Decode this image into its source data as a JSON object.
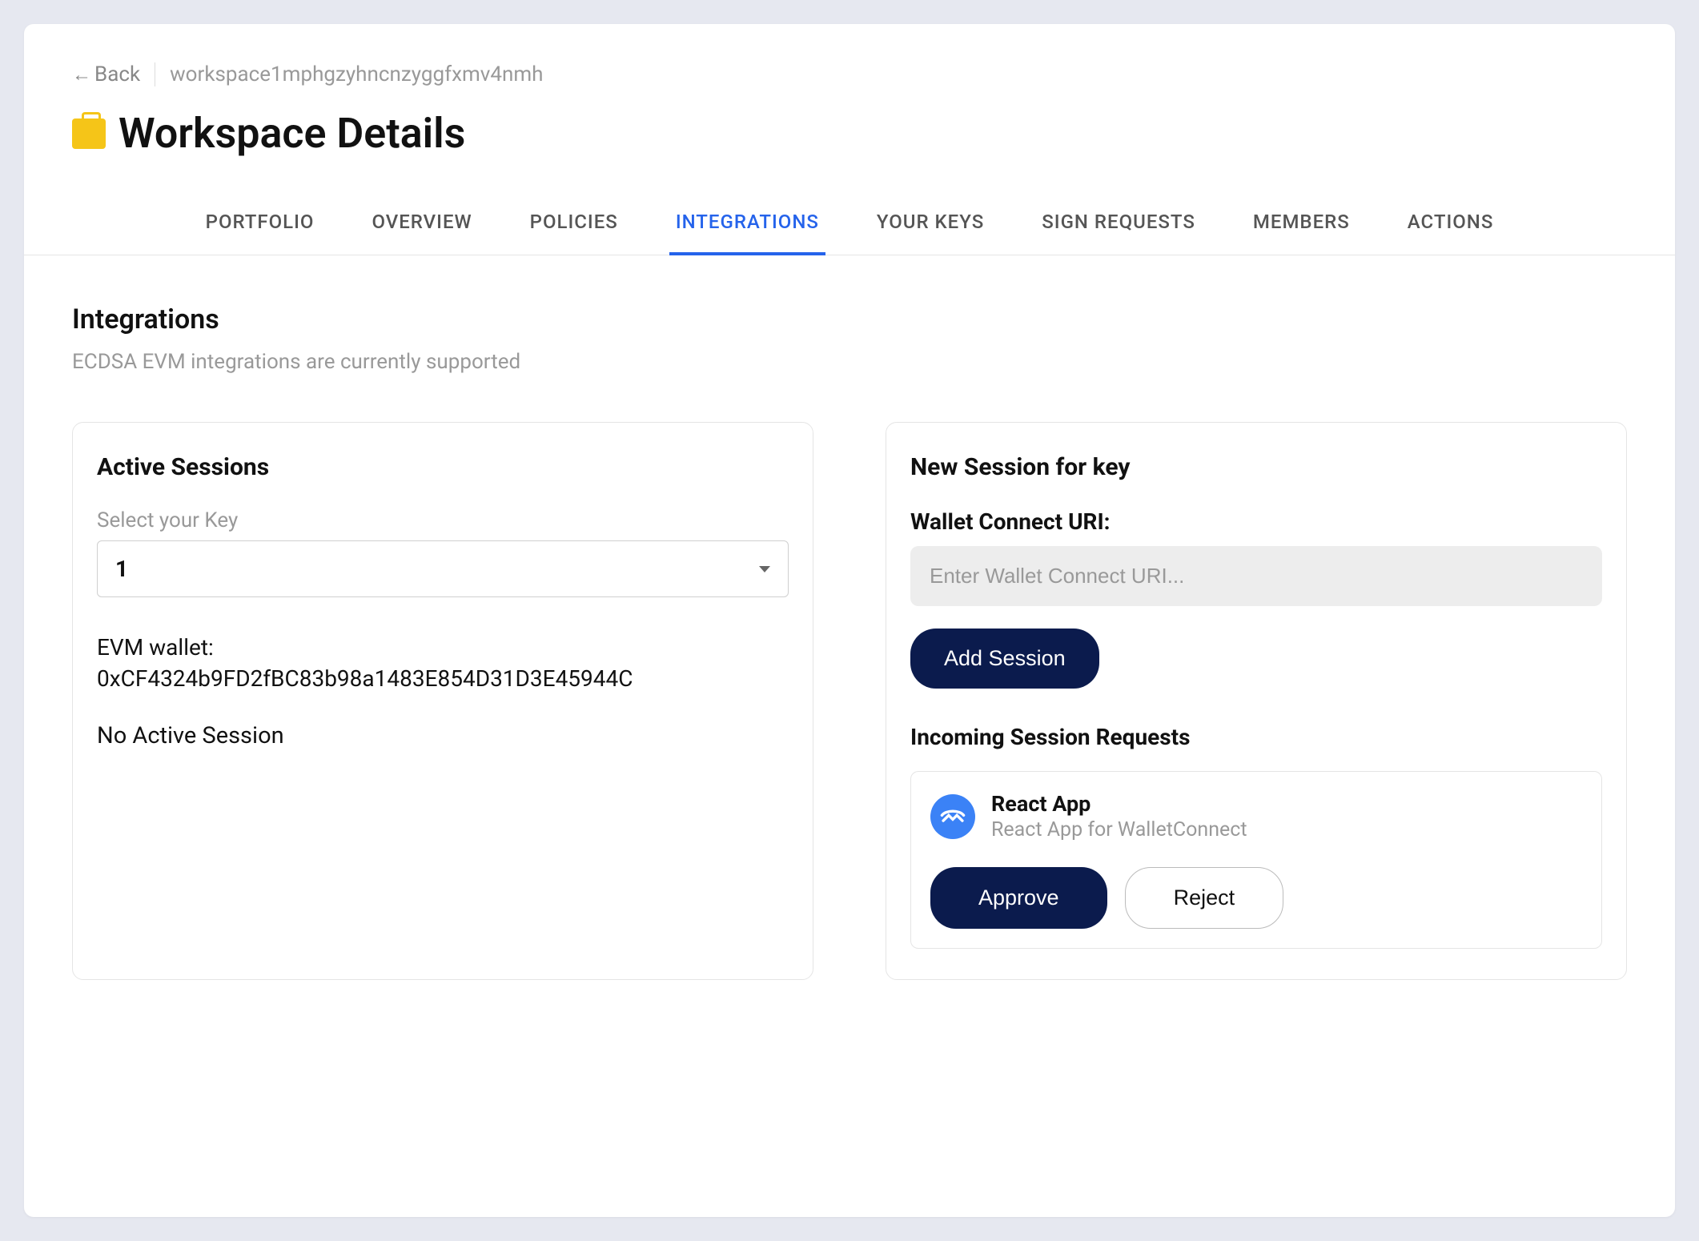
{
  "breadcrumb": {
    "back_label": "Back",
    "workspace_id": "workspace1mphgzyhncnzyggfxmv4nmh"
  },
  "page_title": "Workspace Details",
  "tabs": [
    {
      "label": "PORTFOLIO",
      "active": false
    },
    {
      "label": "OVERVIEW",
      "active": false
    },
    {
      "label": "POLICIES",
      "active": false
    },
    {
      "label": "INTEGRATIONS",
      "active": true
    },
    {
      "label": "YOUR KEYS",
      "active": false
    },
    {
      "label": "SIGN REQUESTS",
      "active": false
    },
    {
      "label": "MEMBERS",
      "active": false
    },
    {
      "label": "ACTIONS",
      "active": false
    }
  ],
  "section": {
    "title": "Integrations",
    "subtitle": "ECDSA EVM integrations are currently supported"
  },
  "left_card": {
    "title": "Active Sessions",
    "select_label": "Select your Key",
    "select_value": "1",
    "evm_label": "EVM wallet:",
    "evm_address": "0xCF4324b9FD2fBC83b98a1483E854D31D3E45944C",
    "no_session": "No Active Session"
  },
  "right_card": {
    "title": "New Session for key",
    "uri_label": "Wallet Connect URI:",
    "uri_placeholder": "Enter Wallet Connect URI...",
    "add_button": "Add Session",
    "incoming_title": "Incoming Session Requests",
    "request": {
      "app_name": "React App",
      "app_desc": "React App for WalletConnect",
      "approve_label": "Approve",
      "reject_label": "Reject"
    }
  }
}
